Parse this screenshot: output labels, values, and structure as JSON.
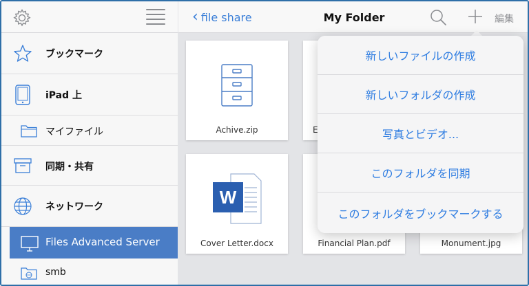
{
  "sidebar": {
    "items": [
      {
        "label": "ブックマーク",
        "icon": "star-icon"
      },
      {
        "label": "iPad 上",
        "icon": "ipad-icon"
      },
      {
        "label": "マイファイル",
        "icon": "folder-icon"
      },
      {
        "label": "同期・共有",
        "icon": "archive-box-icon"
      },
      {
        "label": "ネットワーク",
        "icon": "globe-icon"
      },
      {
        "label": "Files Advanced Server",
        "icon": "monitor-icon"
      },
      {
        "label": "smb",
        "icon": "network-folder-icon"
      }
    ],
    "active_item": "Files Advanced Server"
  },
  "header": {
    "back_label": "file share",
    "title": "My Folder",
    "edit_label": "編集"
  },
  "files": [
    {
      "name": "Achive.zip",
      "icon": "filing-cabinet-icon"
    },
    {
      "name": "E",
      "icon": "file-icon"
    },
    {
      "name": "Cover Letter.docx",
      "icon": "word-document-icon"
    },
    {
      "name": "Financial Plan.pdf",
      "icon": "pdf-icon"
    },
    {
      "name": "Monument.jpg",
      "icon": "image-icon"
    }
  ],
  "menu": {
    "items": [
      "新しいファイルの作成",
      "新しいフォルダの作成",
      "写真とビデオ...",
      "このフォルダを同期",
      "このフォルダをブックマークする"
    ]
  },
  "colors": {
    "accent": "#3b7fd8",
    "active_bg": "#4a7dc6",
    "menu_text": "#2f7de1",
    "frame_border": "#2e6fa8"
  }
}
